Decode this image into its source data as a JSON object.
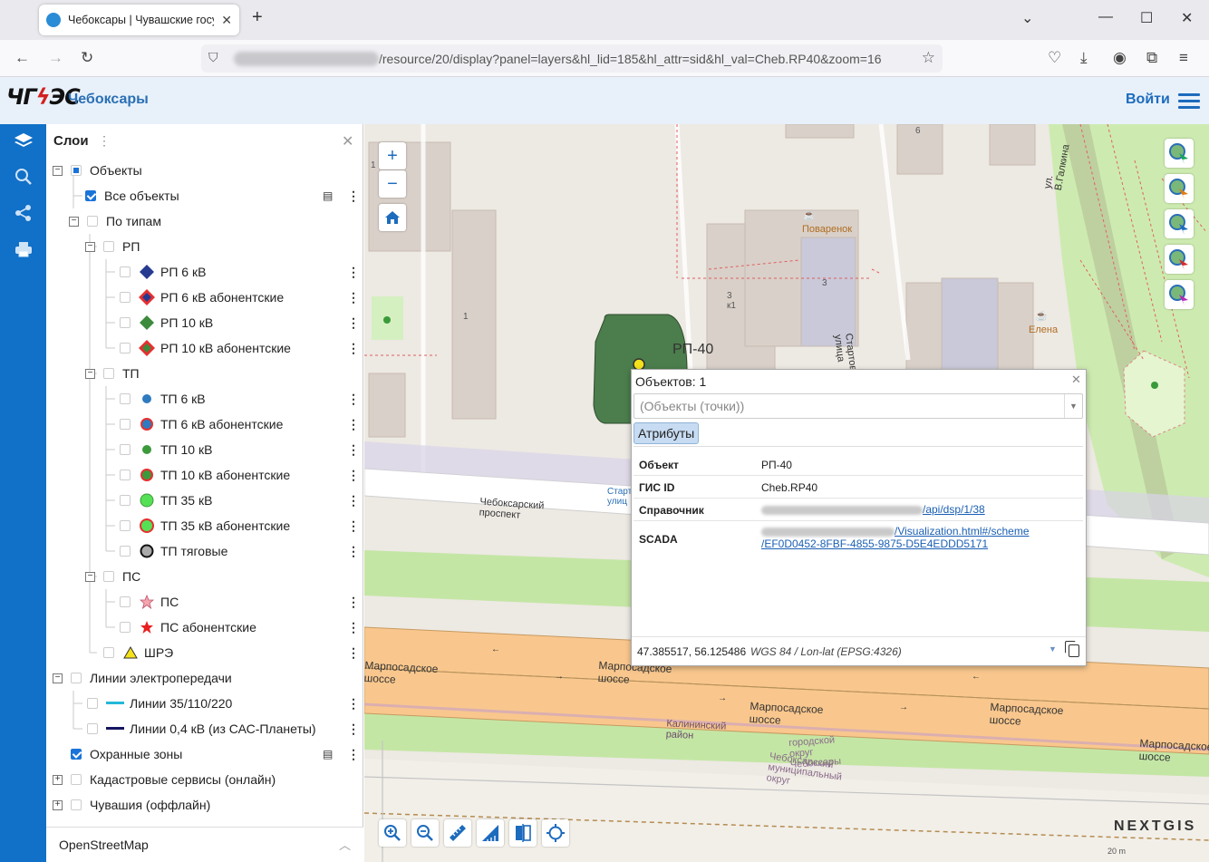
{
  "browser": {
    "tab_title": "Чебоксары | Чувашские госуд",
    "url_path": "/resource/20/display?panel=layers&hl_lid=185&hl_attr=sid&hl_val=Cheb.RP40&zoom=16"
  },
  "header": {
    "city": "Чебоксары",
    "login": "Войти",
    "colors": {
      "header_bg": "#e8f1fa",
      "rail": "#1170c7",
      "accent": "#1d6bbd"
    }
  },
  "rail": {
    "icons": [
      "layers-icon",
      "search-icon",
      "share-icon",
      "print-icon"
    ]
  },
  "layers_panel": {
    "title": "Слои",
    "tree": {
      "objects": "Объекты",
      "all_objects": "Все объекты",
      "by_type": "По типам",
      "rp": "РП",
      "rp_items": [
        "РП 6 кВ",
        "РП 6 кВ абонентские",
        "РП 10 кВ",
        "РП 10 кВ абонентские"
      ],
      "tp": "ТП",
      "tp_items": [
        "ТП 6 кВ",
        "ТП 6 кВ абонентские",
        "ТП 10 кВ",
        "ТП 10 кВ абонентские",
        "ТП 35 кВ",
        "ТП 35 кВ абонентские",
        "ТП тяговые"
      ],
      "ps": "ПС",
      "ps_items": [
        "ПС",
        "ПС абонентские"
      ],
      "shre": "ШРЭ",
      "lines": "Линии электропередачи",
      "line_items": [
        "Линии 35/110/220",
        "Линии 0,4 кВ (из САС-Планеты)"
      ],
      "zones": "Охранные зоны",
      "cadastre": "Кадастровые сервисы (онлайн)",
      "chuvashia": "Чувашия (оффлайн)"
    },
    "basemap": "OpenStreetMap"
  },
  "map": {
    "feature_label": "РП-40",
    "labels": {
      "poi1": "Поваренок",
      "poi2": "Елена",
      "street1": "Чебоксарский проспект",
      "street2": "Марпосадское шоссе",
      "street3": "Стартовая улица",
      "street4": "ул. В.Галкина",
      "district": "Калининский район",
      "okrug1": "городской округ Чебоксары",
      "okrug2": "Чебоксарский муниципальный округ",
      "house1": "1",
      "house2": "6",
      "house3": "3 к1",
      "house4": "3",
      "stop": "Старто улиц"
    },
    "brand": "NEXTGIS",
    "scale": "20 m"
  },
  "popup": {
    "count": "Объектов: 1",
    "select_placeholder": "(Объекты (точки))",
    "tab": "Атрибуты",
    "attrs": [
      {
        "key": "Объект",
        "value": "РП-40"
      },
      {
        "key": "ГИС ID",
        "value": "Cheb.RP40"
      },
      {
        "key": "Справочник",
        "value": "/api/dsp/1/38"
      },
      {
        "key": "SCADA",
        "value": "/Visualization.html#/scheme",
        "value2": "/EF0D0452-8FBF-4855-9875-D5E4EDDD5171"
      }
    ],
    "coords": "47.385517, 56.125486",
    "crs": "WGS 84 / Lon-lat (EPSG:4326)"
  }
}
